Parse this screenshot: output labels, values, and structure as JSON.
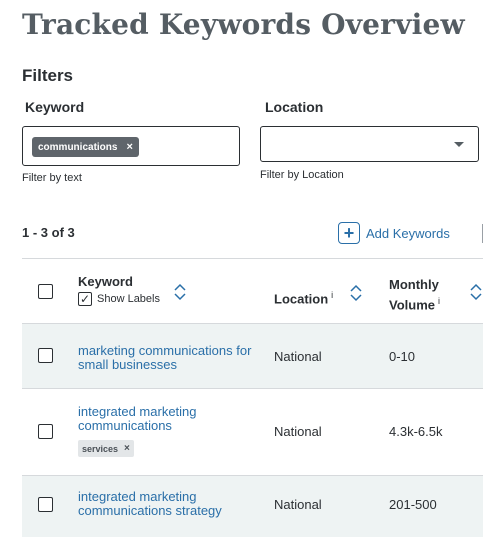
{
  "page": {
    "title": "Tracked Keywords Overview"
  },
  "filters": {
    "heading": "Filters",
    "keyword": {
      "label": "Keyword",
      "chip": "communications",
      "chip_remove": "×",
      "helper": "Filter by text"
    },
    "location": {
      "label": "Location",
      "value": "",
      "helper": "Filter by Location"
    }
  },
  "toolbar": {
    "result_count": "1 - 3 of 3",
    "add_keywords": "Add Keywords",
    "add_icon": "+"
  },
  "table": {
    "headers": {
      "keyword": "Keyword",
      "show_labels": "Show Labels",
      "show_labels_checked": "✓",
      "location": "Location",
      "location_info": "i",
      "volume": "Monthly Volume",
      "volume_info": "i"
    },
    "rows": [
      {
        "keyword": "marketing communications for small businesses",
        "location": "National",
        "volume": "0-10",
        "labels": []
      },
      {
        "keyword": "integrated marketing communications",
        "location": "National",
        "volume": "4.3k-6.5k",
        "labels": [
          "services"
        ],
        "label_remove": "×"
      },
      {
        "keyword": "integrated marketing communications strategy",
        "location": "National",
        "volume": "201-500",
        "labels": []
      }
    ]
  },
  "colors": {
    "link": "#2a6fa8",
    "title": "#555d63",
    "row_shade": "#eef3f3",
    "chip": "#5f656b"
  }
}
